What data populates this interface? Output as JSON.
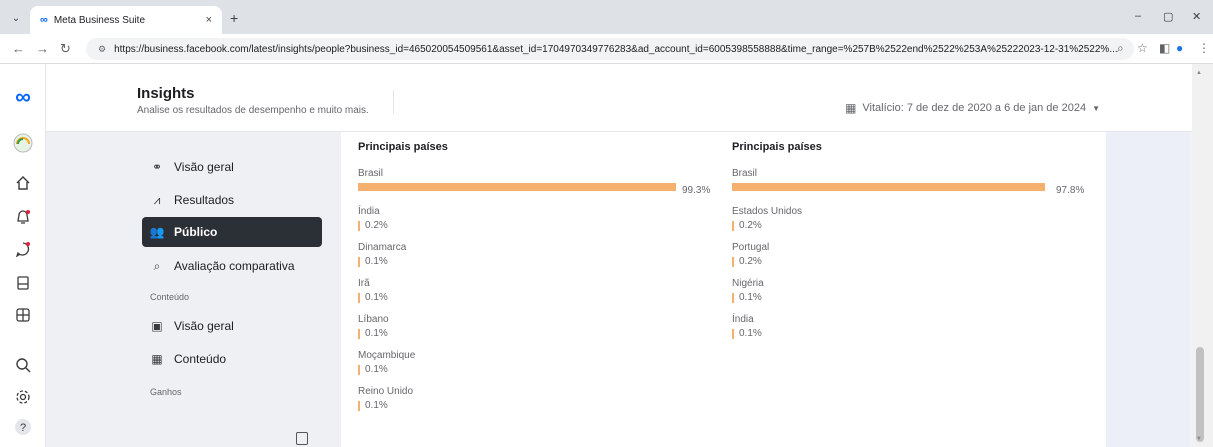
{
  "browser": {
    "tab_title": "Meta Business Suite",
    "tab_close": "×",
    "new_tab": "+",
    "url": "https://business.facebook.com/latest/insights/people?business_id=465020054509561&asset_id=1704970349776283&ad_account_id=6005398558888&time_range=%257B%2522end%2522%253A%25222023-12-31%2522%...",
    "win_minimize": "–",
    "win_maximize": "▢",
    "win_close": "✕"
  },
  "header": {
    "title": "Insights",
    "subtitle": "Analise os resultados de desempenho e muito mais.",
    "date_range": "Vitalício: 7 de dez de 2020 a 6 de jan de 2024"
  },
  "subnav": {
    "items": [
      {
        "label": "Visão geral",
        "icon": "network-icon"
      },
      {
        "label": "Resultados",
        "icon": "trend-icon"
      },
      {
        "label": "Público",
        "icon": "people-icon"
      },
      {
        "label": "Avaliação comparativa",
        "icon": "benchmark-icon"
      }
    ],
    "section_content": "Conteúdo",
    "content_items": [
      {
        "label": "Visão geral",
        "icon": "content-overview-icon"
      },
      {
        "label": "Conteúdo",
        "icon": "table-icon"
      }
    ],
    "section_gains": "Ganhos"
  },
  "panels": [
    {
      "title": "Principais países",
      "countries": [
        {
          "name": "Brasil",
          "pct": "99.3%",
          "value": 99.3
        },
        {
          "name": "Índia",
          "pct": "0.2%",
          "value": 0.2
        },
        {
          "name": "Dinamarca",
          "pct": "0.1%",
          "value": 0.1
        },
        {
          "name": "Irã",
          "pct": "0.1%",
          "value": 0.1
        },
        {
          "name": "Líbano",
          "pct": "0.1%",
          "value": 0.1
        },
        {
          "name": "Moçambique",
          "pct": "0.1%",
          "value": 0.1
        },
        {
          "name": "Reino Unido",
          "pct": "0.1%",
          "value": 0.1
        }
      ]
    },
    {
      "title": "Principais países",
      "countries": [
        {
          "name": "Brasil",
          "pct": "97.8%",
          "value": 97.8
        },
        {
          "name": "Estados Unidos",
          "pct": "0.2%",
          "value": 0.2
        },
        {
          "name": "Portugal",
          "pct": "0.2%",
          "value": 0.2
        },
        {
          "name": "Nigéria",
          "pct": "0.1%",
          "value": 0.1
        },
        {
          "name": "Índia",
          "pct": "0.1%",
          "value": 0.1
        }
      ]
    }
  ],
  "colors": {
    "bar": "#f5b06d",
    "active_nav": "#2b2f36",
    "meta_blue": "#0866ff"
  }
}
